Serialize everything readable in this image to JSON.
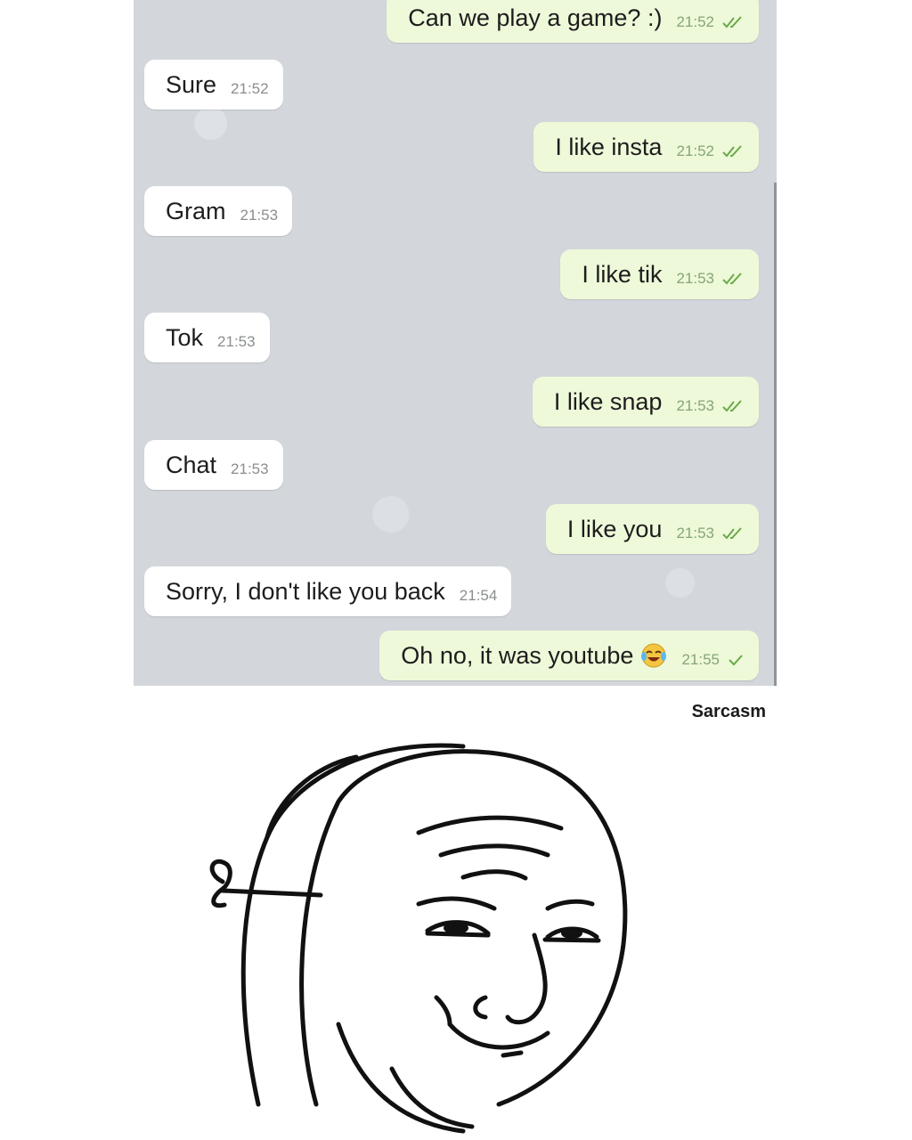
{
  "chat": {
    "messages": [
      {
        "direction": "out",
        "text": "Can we play a game? :)",
        "time": "21:52",
        "ticks": "double"
      },
      {
        "direction": "in",
        "text": "Sure",
        "time": "21:52"
      },
      {
        "direction": "out",
        "text": "I like insta",
        "time": "21:52",
        "ticks": "double"
      },
      {
        "direction": "in",
        "text": "Gram",
        "time": "21:53"
      },
      {
        "direction": "out",
        "text": "I like tik",
        "time": "21:53",
        "ticks": "double"
      },
      {
        "direction": "in",
        "text": "Tok",
        "time": "21:53"
      },
      {
        "direction": "out",
        "text": "I like snap",
        "time": "21:53",
        "ticks": "double"
      },
      {
        "direction": "in",
        "text": "Chat",
        "time": "21:53"
      },
      {
        "direction": "out",
        "text": "I like you",
        "time": "21:53",
        "ticks": "double"
      },
      {
        "direction": "in",
        "text": "Sorry, I don't like you back",
        "time": "21:54"
      },
      {
        "direction": "out",
        "text": "Oh no, it was youtube",
        "time": "21:55",
        "ticks": "single",
        "emoji": "tears-of-joy-emoji"
      }
    ]
  },
  "watermark": "Sarcasm",
  "image": {
    "icon": "wojak-smug-mask-face-icon"
  },
  "colors": {
    "chat_background": "#d3d7dc",
    "outgoing_bubble": "#eef9d9",
    "incoming_bubble": "#ffffff",
    "tick_color": "#6aaa4a"
  }
}
